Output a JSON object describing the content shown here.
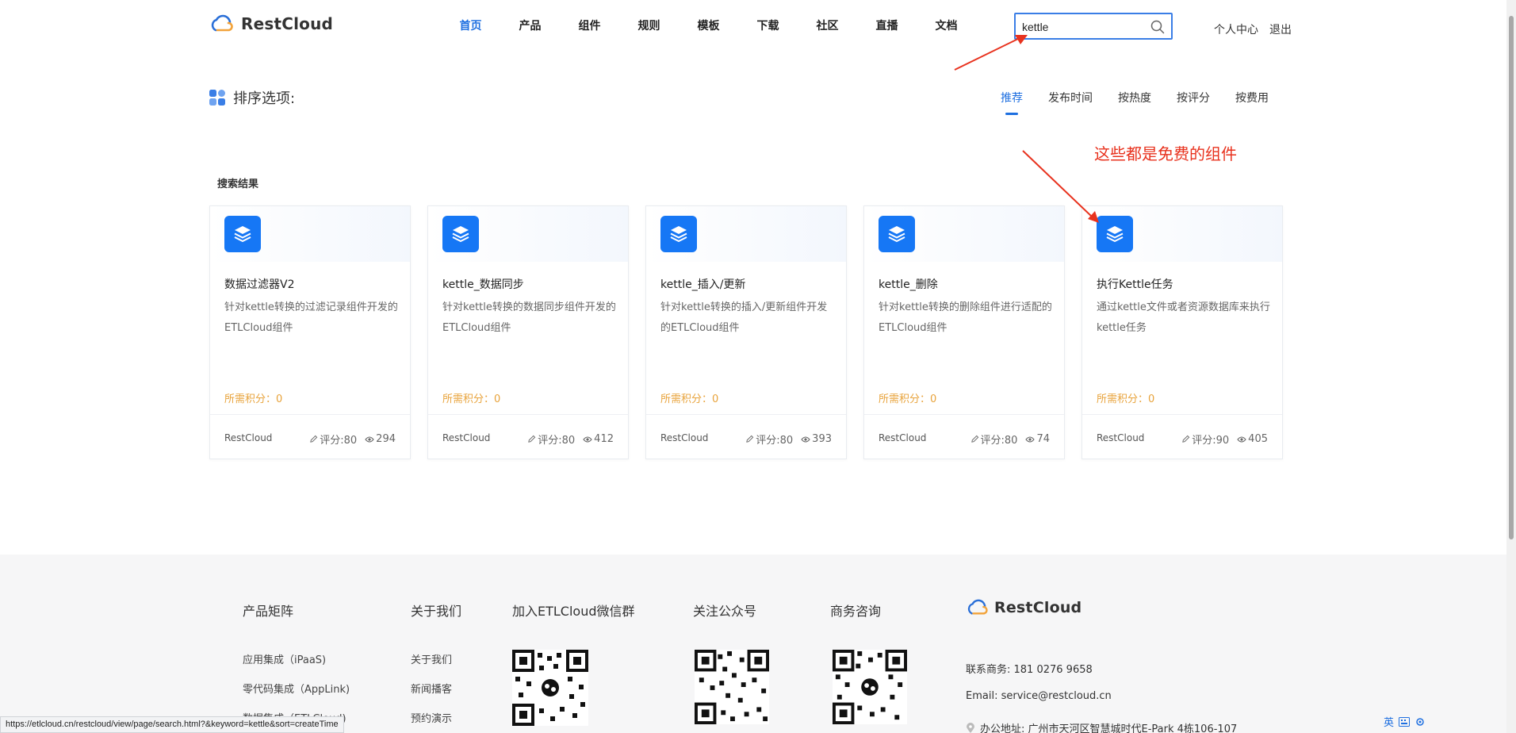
{
  "header": {
    "logo_text": "RestCloud",
    "nav": [
      "首页",
      "产品",
      "组件",
      "规则",
      "模板",
      "下载",
      "社区",
      "直播",
      "文档"
    ],
    "active_nav": 0,
    "search_value": "kettle",
    "user_center": "个人中心",
    "logout": "退出"
  },
  "sort": {
    "title": "排序选项:",
    "options": [
      "推荐",
      "发布时间",
      "按热度",
      "按评分",
      "按费用"
    ],
    "active": 0
  },
  "annotation": "这些都是免费的组件",
  "results_label": "搜索结果",
  "cards": [
    {
      "name": "数据过滤器V2",
      "desc": "针对kettle转换的过滤记录组件开发的ETLCloud组件",
      "points": "所需积分：0",
      "author": "RestCloud",
      "rating": "评分:80",
      "views": "294"
    },
    {
      "name": "kettle_数据同步",
      "desc": "针对kettle转换的数据同步组件开发的ETLCloud组件",
      "points": "所需积分：0",
      "author": "RestCloud",
      "rating": "评分:80",
      "views": "412"
    },
    {
      "name": "kettle_插入/更新",
      "desc": "针对kettle转换的插入/更新组件开发的ETLCloud组件",
      "points": "所需积分：0",
      "author": "RestCloud",
      "rating": "评分:80",
      "views": "393"
    },
    {
      "name": "kettle_删除",
      "desc": "针对kettle转换的删除组件进行适配的ETLCloud组件",
      "points": "所需积分：0",
      "author": "RestCloud",
      "rating": "评分:80",
      "views": "74"
    },
    {
      "name": "执行Kettle任务",
      "desc": "通过kettle文件或者资源数据库来执行kettle任务",
      "points": "所需积分：0",
      "author": "RestCloud",
      "rating": "评分:90",
      "views": "405"
    }
  ],
  "footer": {
    "col1_title": "产品矩阵",
    "col1_links": [
      "应用集成（iPaaS)",
      "零代码集成（AppLink)",
      "数据集成（ETLCloud)"
    ],
    "col2_title": "关于我们",
    "col2_links": [
      "关于我们",
      "新闻播客",
      "预约演示"
    ],
    "col3_title": "加入ETLCloud微信群",
    "col4_title": "关注公众号",
    "col5_title": "商务咨询",
    "logo_text": "RestCloud",
    "phone": "联系商务: 181 0276 9658",
    "email": "Email: service@restcloud.cn",
    "address": "办公地址: 广州市天河区智慧城时代E-Park 4栋106-107"
  },
  "status_url": "https://etlcloud.cn/restcloud/view/page/search.html?&keyword=kettle&sort=createTime",
  "tray": {
    "lang": "英"
  },
  "colors": {
    "brand_blue": "#1677f5",
    "accent_blue": "#1e6fe0",
    "annotation_red": "#e8321e",
    "points_orange": "#e8a33b"
  }
}
